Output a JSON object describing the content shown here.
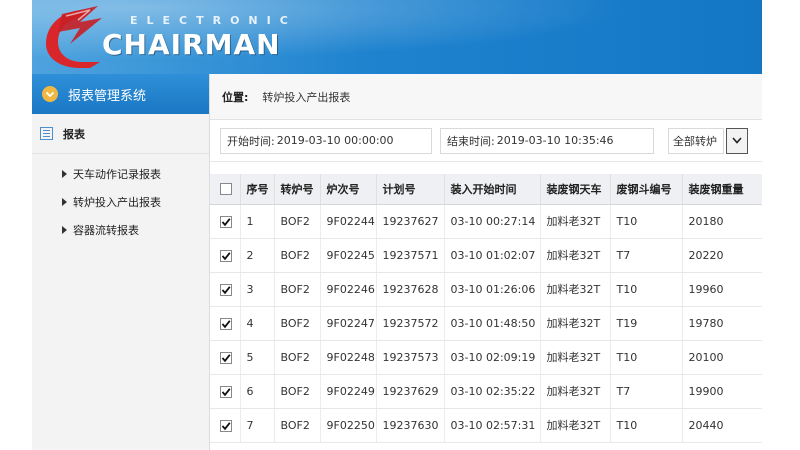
{
  "brand": {
    "top": "ELECTRONIC",
    "main": "CHAIRMAN"
  },
  "sidebar": {
    "title": "报表管理系统",
    "group": "报表",
    "items": [
      {
        "label": "天车动作记录报表"
      },
      {
        "label": "转炉投入产出报表"
      },
      {
        "label": "容器流转报表"
      }
    ]
  },
  "breadcrumb": {
    "label": "位置:",
    "value": "转炉投入产出报表"
  },
  "filters": {
    "start_label": "开始时间:",
    "start_value": "2019-03-10 00:00:00",
    "end_label": "结束时间:",
    "end_value": "2019-03-10 10:35:46",
    "furnace_select": "全部转炉"
  },
  "table": {
    "columns": [
      "序号",
      "转炉号",
      "炉次号",
      "计划号",
      "装入开始时间",
      "装废钢天车",
      "废钢斗编号",
      "装废钢重量"
    ],
    "rows": [
      [
        "1",
        "BOF2",
        "9F02244",
        "19237627",
        "03-10 00:27:14",
        "加料老32T",
        "T10",
        "20180"
      ],
      [
        "2",
        "BOF2",
        "9F02245",
        "19237571",
        "03-10 01:02:07",
        "加料老32T",
        "T7",
        "20220"
      ],
      [
        "3",
        "BOF2",
        "9F02246",
        "19237628",
        "03-10 01:26:06",
        "加料老32T",
        "T10",
        "19960"
      ],
      [
        "4",
        "BOF2",
        "9F02247",
        "19237572",
        "03-10 01:48:50",
        "加料老32T",
        "T19",
        "19780"
      ],
      [
        "5",
        "BOF2",
        "9F02248",
        "19237573",
        "03-10 02:09:19",
        "加料老32T",
        "T10",
        "20100"
      ],
      [
        "6",
        "BOF2",
        "9F02249",
        "19237629",
        "03-10 02:35:22",
        "加料老32T",
        "T7",
        "19900"
      ],
      [
        "7",
        "BOF2",
        "9F02250",
        "19237630",
        "03-10 02:57:31",
        "加料老32T",
        "T10",
        "20440"
      ]
    ],
    "checked": [
      true,
      true,
      true,
      true,
      true,
      true,
      true
    ]
  },
  "colors": {
    "header_blue": "#1f83cf",
    "accent_orange": "#f0b840",
    "logo_red": "#d9262b"
  }
}
